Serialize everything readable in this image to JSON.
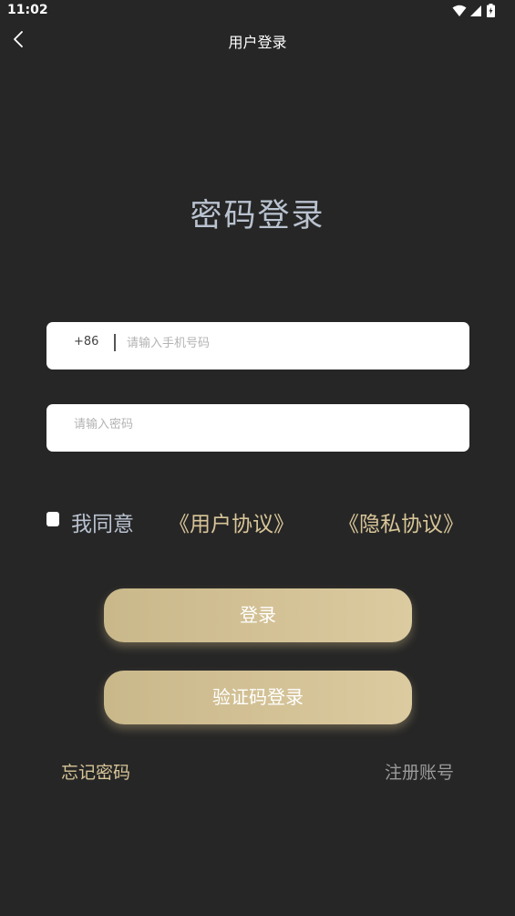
{
  "status_bar": {
    "time": "11:02",
    "icons": [
      "wifi-icon",
      "signal-icon",
      "battery-icon"
    ]
  },
  "nav": {
    "title": "用户登录",
    "back_icon": "chevron-left-icon"
  },
  "heading": "密码登录",
  "phone": {
    "country_code": "+86",
    "placeholder": "请输入手机号码",
    "value": ""
  },
  "password": {
    "placeholder": "请输入密码",
    "value": ""
  },
  "agreement": {
    "checked": false,
    "prefix": "我同意",
    "user_agreement": "《用户协议》",
    "privacy_policy": "《隐私协议》"
  },
  "buttons": {
    "login": "登录",
    "code_login": "验证码登录"
  },
  "links": {
    "forgot_password": "忘记密码",
    "register": "注册账号"
  },
  "colors": {
    "background": "#262626",
    "heading": "#b9c2cf",
    "gold_link": "#d8c598",
    "button_gold_start": "#c9b88a",
    "button_gold_end": "#dccaa0",
    "register_link": "#9a9a9a"
  }
}
